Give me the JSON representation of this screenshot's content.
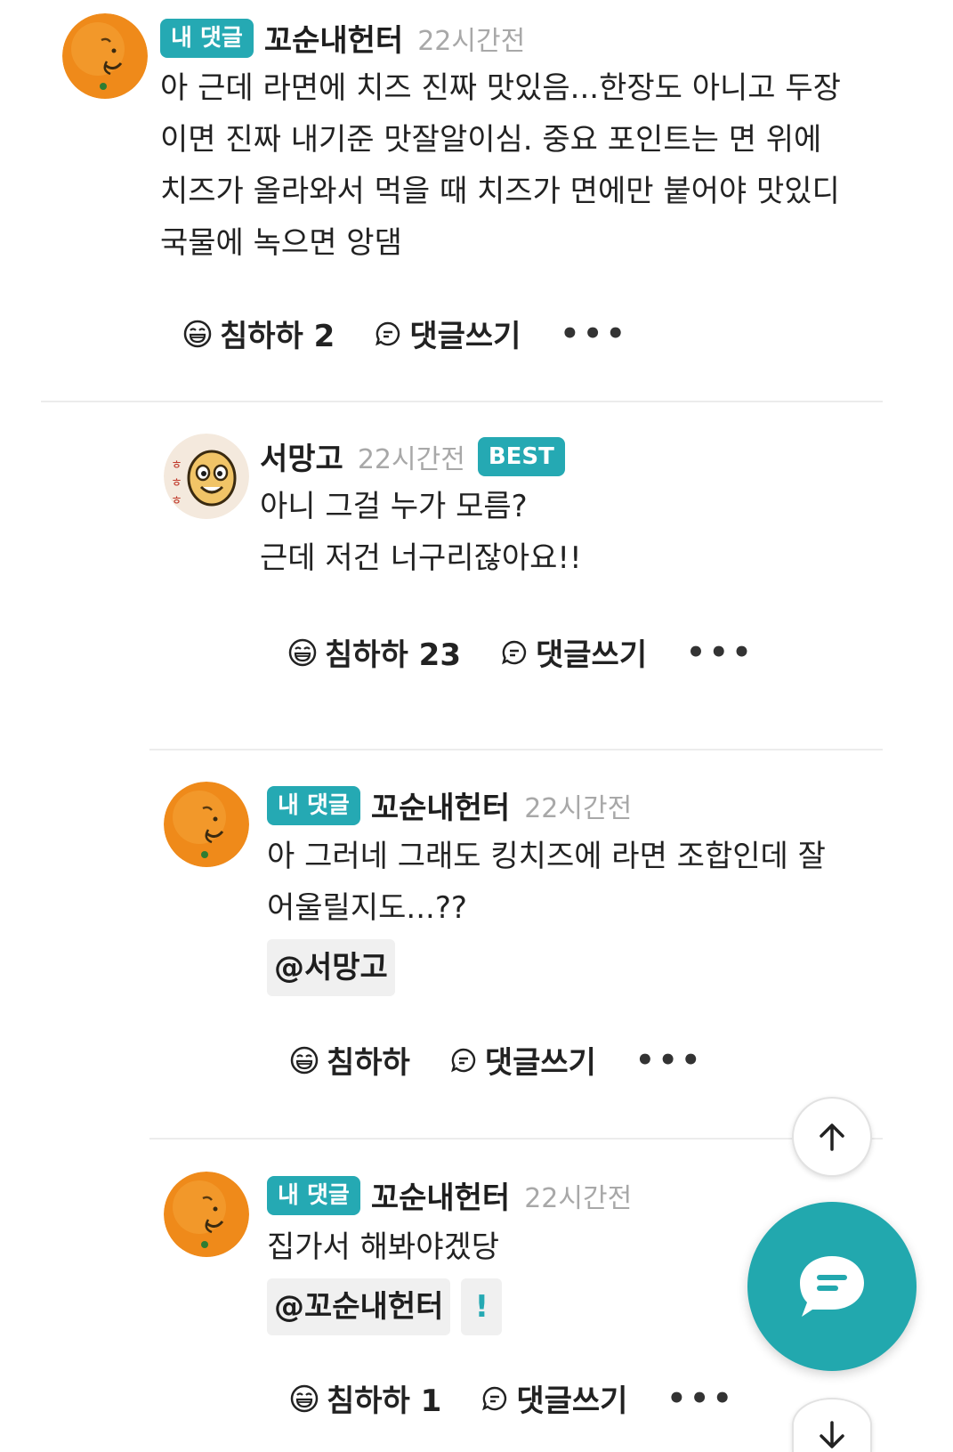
{
  "comments": [
    {
      "my_badge": "내 댓글",
      "nick": "꼬순내헌터",
      "time": "22시간전",
      "lines": [
        "아 근데 라면에 치즈 진짜 맛있음...한장도 아니고 두장",
        "이면 진짜 내기준 맛잘알이심. 중요 포인트는 면 위에",
        "치즈가 올라와서 먹을 때 치즈가 면에만 붙어야 맛있디",
        "국물에 녹으면 앙댐"
      ],
      "like_label": "침하하 2",
      "reply_label": "댓글쓰기",
      "more": "•••"
    },
    {
      "nick": "서망고",
      "time": "22시간전",
      "best_badge": "BEST",
      "lines": [
        "아니 그걸 누가 모름?",
        "근데 저건 너구리잖아요!!"
      ],
      "like_label": "침하하 23",
      "reply_label": "댓글쓰기",
      "more": "•••"
    },
    {
      "my_badge": "내 댓글",
      "nick": "꼬순내헌터",
      "time": "22시간전",
      "lines": [
        "아 그러네 그래도 킹치즈에 라면 조합인데 잘",
        "어울릴지도...??"
      ],
      "mention": "@서망고",
      "like_label": "침하하",
      "reply_label": "댓글쓰기",
      "more": "•••"
    },
    {
      "my_badge": "내 댓글",
      "nick": "꼬순내헌터",
      "time": "22시간전",
      "lines": [
        "집가서 해봐야겠당"
      ],
      "mention": "@꼬순내헌터",
      "extra_mark": "!",
      "like_label": "침하하 1",
      "reply_label": "댓글쓰기",
      "more": "•••"
    }
  ],
  "colors": {
    "accent": "#25a9b3",
    "fab": "#22a8ae",
    "muted": "#a8a8a8"
  },
  "icons": {
    "like": "laughing-face-icon",
    "reply": "speech-bubble-icon",
    "up": "arrow-up-icon",
    "down": "arrow-down-icon",
    "chat": "chat-bubble-icon"
  }
}
